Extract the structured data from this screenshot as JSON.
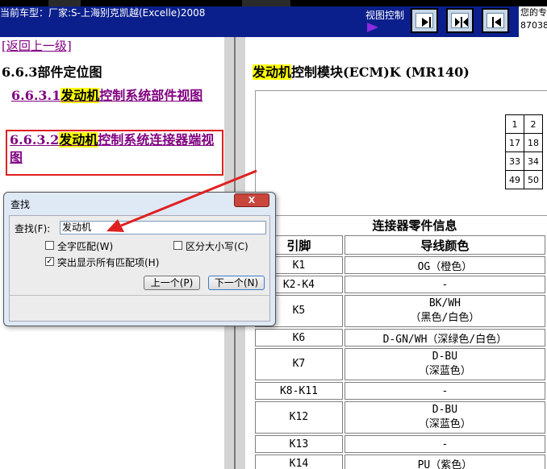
{
  "header": {
    "car_model": "当前车型：厂家:S-上海别克凯越(Excelle)2008",
    "view_control": "视图控制",
    "info_line1": "您的专",
    "info_line2": "87038"
  },
  "left_pane": {
    "back_link": "[返回上一级]",
    "section_title": "6.6.3部件定位图",
    "link1_pre": "6.6.3.1",
    "link1_hl": "发动机",
    "link1_post": "控制系统部件视图",
    "link2_pre": "6.6.3.2",
    "link2_hl": "发动机",
    "link2_post": "控制系统连接器端视图"
  },
  "right_pane": {
    "title_hl": "发动机",
    "title_rest": "控制模块(ECM)K (MR140)",
    "pin_grid": [
      [
        "1",
        "2"
      ],
      [
        "17",
        "18"
      ],
      [
        "33",
        "34"
      ],
      [
        "49",
        "50"
      ]
    ],
    "table_title": "连接器零件信息",
    "col_pin": "引脚",
    "col_color": "导线颜色",
    "rows": [
      {
        "pin": "K1",
        "color": "OG（橙色）",
        "color2": ""
      },
      {
        "pin": "K2-K4",
        "color": "-",
        "color2": ""
      },
      {
        "pin": "K5",
        "color": "BK/WH",
        "color2": "（黑色/白色）"
      },
      {
        "pin": "K6",
        "color": "D-GN/WH（深绿色/白色）",
        "color2": ""
      },
      {
        "pin": "K7",
        "color": "D-BU",
        "color2": "（深蓝色）"
      },
      {
        "pin": "K8-K11",
        "color": "-",
        "color2": ""
      },
      {
        "pin": "K12",
        "color": "D-BU",
        "color2": "（深蓝色）"
      },
      {
        "pin": "K13",
        "color": "-",
        "color2": ""
      },
      {
        "pin": "K14",
        "color": "PU（紫色）",
        "color2": ""
      }
    ]
  },
  "find_dialog": {
    "title": "查找",
    "close": "X",
    "find_label": "查找(F):",
    "find_value": "发动机",
    "whole_word": "全字匹配(W)",
    "match_case": "区分大小写(C)",
    "highlight_all": "突出显示所有匹配项(H)",
    "highlight_all_checked": true,
    "prev_button": "上一个(P)",
    "next_button": "下一个(N)"
  },
  "colors": {
    "header_bg": "#0b1f8c",
    "link": "#800080",
    "highlight": "#ffff00",
    "annotation": "#e02020"
  }
}
